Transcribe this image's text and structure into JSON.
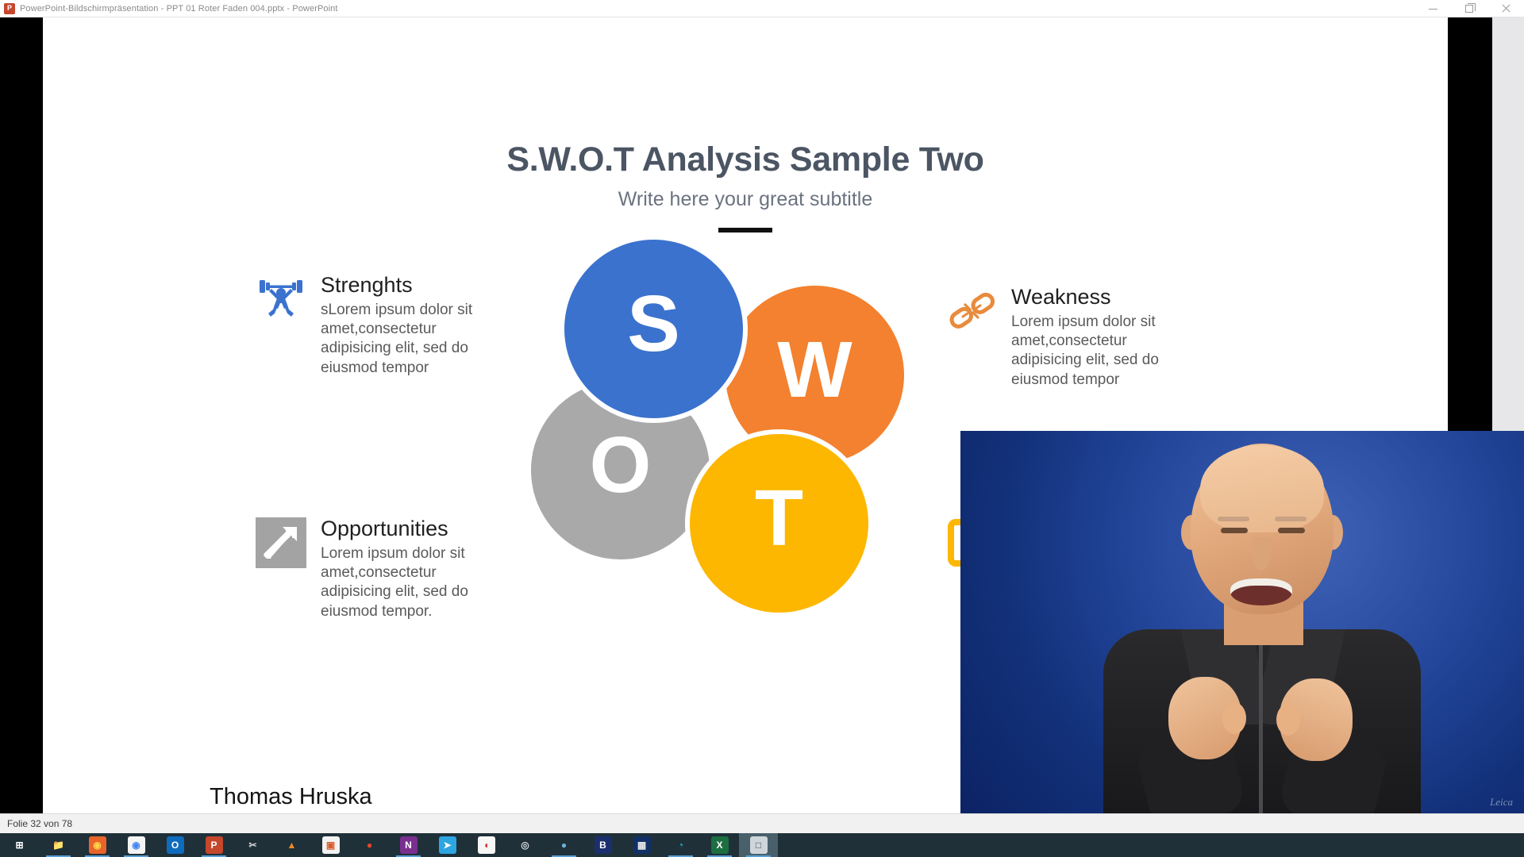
{
  "window": {
    "title": "PowerPoint-Bildschirmpräsentation  -  PPT 01 Roter Faden 004.pptx - PowerPoint",
    "app_icon": "powerpoint-icon",
    "app_icon_letter": "P",
    "minimize_label": "—",
    "maximize_label": "❐",
    "close_label": "✕"
  },
  "slide": {
    "title": "S.W.O.T Analysis Sample Two",
    "subtitle": "Write here your great subtitle",
    "presenter": "Thomas Hruska",
    "quadrants": [
      {
        "key": "strengths",
        "icon": "weightlifter-icon",
        "heading": "Strenghts",
        "body": "sLorem ipsum dolor sit amet,consectetur adipisicing elit, sed do eiusmod tempor",
        "color": "#3b72ce"
      },
      {
        "key": "weakness",
        "icon": "broken-chain-icon",
        "heading": "Weakness",
        "body": "Lorem ipsum dolor sit amet,consectetur adipisicing elit, sed do eiusmod tempor",
        "color": "#e88b3c"
      },
      {
        "key": "opportunities",
        "icon": "arrow-up-right-icon",
        "heading": "Opportunities",
        "body": "Lorem ipsum dolor sit amet,consectetur adipisicing elit, sed do eiusmod tempor.",
        "color": "#a3a3a3"
      },
      {
        "key": "threats",
        "icon": "warning-alert-icon",
        "heading": "",
        "body": "",
        "color": "#fdb700"
      }
    ],
    "diagram": {
      "type": "swot-circles",
      "circles": [
        {
          "letter": "S",
          "name": "strengths-circle",
          "color": "#3b72ce"
        },
        {
          "letter": "W",
          "name": "weakness-circle",
          "color": "#f3812f"
        },
        {
          "letter": "O",
          "name": "opportunities-circle",
          "color": "#a9a9a9"
        },
        {
          "letter": "T",
          "name": "threats-circle",
          "color": "#fdb700"
        }
      ]
    }
  },
  "webcam": {
    "label": "presenter-webcam-overlay",
    "watermark": "Leica"
  },
  "status": {
    "slide_counter": "Folie 32 von 78"
  },
  "taskbar": {
    "items": [
      {
        "name": "start-button",
        "glyph": "⊞",
        "bg": "transparent",
        "fg": "#ffffff",
        "running": false,
        "active": false
      },
      {
        "name": "file-explorer-icon",
        "glyph": "📁",
        "bg": "transparent",
        "fg": "#e8b84b",
        "running": true,
        "active": false
      },
      {
        "name": "firefox-icon",
        "glyph": "◉",
        "bg": "#e8642a",
        "fg": "#ffd24a",
        "running": true,
        "active": false
      },
      {
        "name": "google-chrome-icon",
        "glyph": "◉",
        "bg": "#f4f4f4",
        "fg": "#4285f4",
        "running": true,
        "active": false
      },
      {
        "name": "outlook-icon",
        "glyph": "O",
        "bg": "#0f6cbd",
        "fg": "#ffffff",
        "running": false,
        "active": false
      },
      {
        "name": "powerpoint-icon",
        "glyph": "P",
        "bg": "#c5472c",
        "fg": "#ffffff",
        "running": true,
        "active": false
      },
      {
        "name": "snipping-tool-icon",
        "glyph": "✂",
        "bg": "transparent",
        "fg": "#d8d8d8",
        "running": false,
        "active": false
      },
      {
        "name": "vlc-player-icon",
        "glyph": "▲",
        "bg": "transparent",
        "fg": "#f08a24",
        "running": false,
        "active": false
      },
      {
        "name": "photo-viewer-icon",
        "glyph": "▣",
        "bg": "#f2f2f2",
        "fg": "#d85a2a",
        "running": false,
        "active": false
      },
      {
        "name": "lips-app-icon",
        "glyph": "●",
        "bg": "transparent",
        "fg": "#e8452c",
        "running": false,
        "active": false
      },
      {
        "name": "onenote-icon",
        "glyph": "N",
        "bg": "#7a2f8f",
        "fg": "#ffffff",
        "running": true,
        "active": false
      },
      {
        "name": "telegram-icon",
        "glyph": "➤",
        "bg": "#2ca5e0",
        "fg": "#ffffff",
        "running": false,
        "active": false
      },
      {
        "name": "camtasia-icon",
        "glyph": "◖",
        "bg": "#f6f6f6",
        "fg": "#d2232a",
        "running": false,
        "active": false
      },
      {
        "name": "obs-studio-icon",
        "glyph": "◎",
        "bg": "transparent",
        "fg": "#d9d9d9",
        "running": false,
        "active": false
      },
      {
        "name": "recorder-icon",
        "glyph": "●",
        "bg": "transparent",
        "fg": "#6fb0d8",
        "running": true,
        "active": false
      },
      {
        "name": "blue-mic-icon",
        "glyph": "B",
        "bg": "#1b2f6e",
        "fg": "#ffffff",
        "running": false,
        "active": false
      },
      {
        "name": "video-editor-icon",
        "glyph": "▦",
        "bg": "#123066",
        "fg": "#e8e8e8",
        "running": false,
        "active": false
      },
      {
        "name": "microsoft-edge-icon",
        "glyph": "◔",
        "bg": "transparent",
        "fg": "#2bb5e0",
        "running": true,
        "active": false
      },
      {
        "name": "excel-icon",
        "glyph": "X",
        "bg": "#1d6f42",
        "fg": "#ffffff",
        "running": true,
        "active": false
      },
      {
        "name": "display-settings-icon",
        "glyph": "□",
        "bg": "#cfd6da",
        "fg": "#44525a",
        "running": true,
        "active": true
      }
    ]
  }
}
